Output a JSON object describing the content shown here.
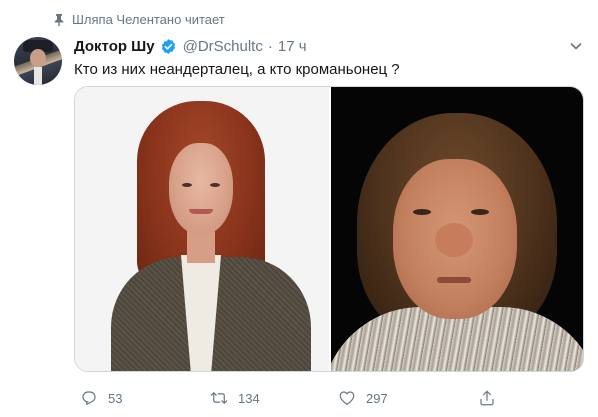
{
  "context": {
    "text": "Шляпа Челентано читает",
    "icon": "pin-icon"
  },
  "tweet": {
    "author_name": "Доктор Шу",
    "verified": true,
    "handle": "@DrSchultc",
    "separator": "·",
    "time": "17 ч",
    "text": "Кто из них неандерталец, а кто кроманьонец ?"
  },
  "actions": {
    "reply_count": "53",
    "retweet_count": "134",
    "like_count": "297"
  },
  "colors": {
    "accent": "#1da1f2",
    "muted": "#657786",
    "text": "#14171a",
    "border": "#ccd6dd"
  }
}
